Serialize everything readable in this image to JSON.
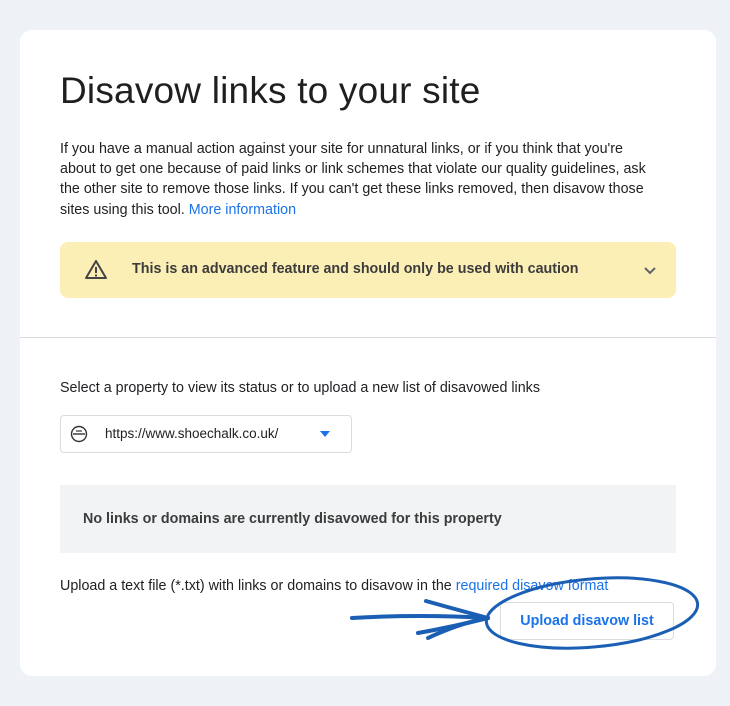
{
  "page": {
    "title": "Disavow links to your site",
    "description": "If you have a manual action against your site for unnatural links, or if you think that you're about to get one because of paid links or link schemes that violate our quality guidelines, ask the other site to remove those links. If you can't get these links removed, then disavow those sites using this tool.",
    "more_info_link": "More information"
  },
  "warning": {
    "icon": "warning-triangle-icon",
    "text": "This is an advanced feature and should only be used with caution",
    "expand_icon": "chevron-down-icon"
  },
  "property": {
    "label": "Select a property to view its status or to upload a new list of disavowed links",
    "selected": "https://www.shoechalk.co.uk/",
    "icon": "url-prefix-property-icon"
  },
  "status": {
    "message": "No links or domains are currently disavowed for this property"
  },
  "upload": {
    "text": "Upload a text file (*.txt) with links or domains to disavow in the",
    "format_link": "required disavow format",
    "button_label": "Upload disavow list"
  },
  "colors": {
    "accent": "#1a73e8",
    "warning_bg": "#fcefb6",
    "annotation": "#1a5fb4"
  }
}
